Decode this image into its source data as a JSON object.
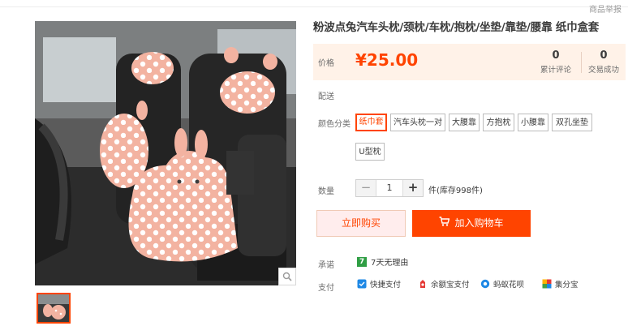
{
  "header": {
    "report_label": "商品举报"
  },
  "product": {
    "title": "粉波点兔汽车头枕/颈枕/车枕/抱枕/坐垫/靠垫/腰靠 纸巾盒套",
    "price_label": "价格",
    "price": "¥25.00",
    "reviews": {
      "value": "0",
      "label": "累计评论"
    },
    "sales": {
      "value": "0",
      "label": "交易成功"
    }
  },
  "delivery": {
    "label": "配送"
  },
  "color": {
    "label": "颜色分类",
    "options": [
      "纸巾套",
      "汽车头枕一对",
      "大腰靠",
      "方抱枕",
      "小腰靠",
      "双孔坐垫",
      "U型枕"
    ],
    "selected": "纸巾套"
  },
  "quantity": {
    "label": "数量",
    "minus": "−",
    "value": "1",
    "plus": "+",
    "stock_text": "件(库存998件)"
  },
  "actions": {
    "buy_now": "立即购买",
    "add_to_cart": "加入购物车"
  },
  "promise": {
    "label": "承诺",
    "badge": "7",
    "text": "7天无理由"
  },
  "payment": {
    "label": "支付",
    "methods": [
      "快捷支付",
      "余额宝支付",
      "蚂蚁花呗",
      "集分宝"
    ]
  },
  "colors": {
    "accent": "#ff4400",
    "price_bg": "#fff2e8",
    "promise_badge": "#2f9e44"
  }
}
